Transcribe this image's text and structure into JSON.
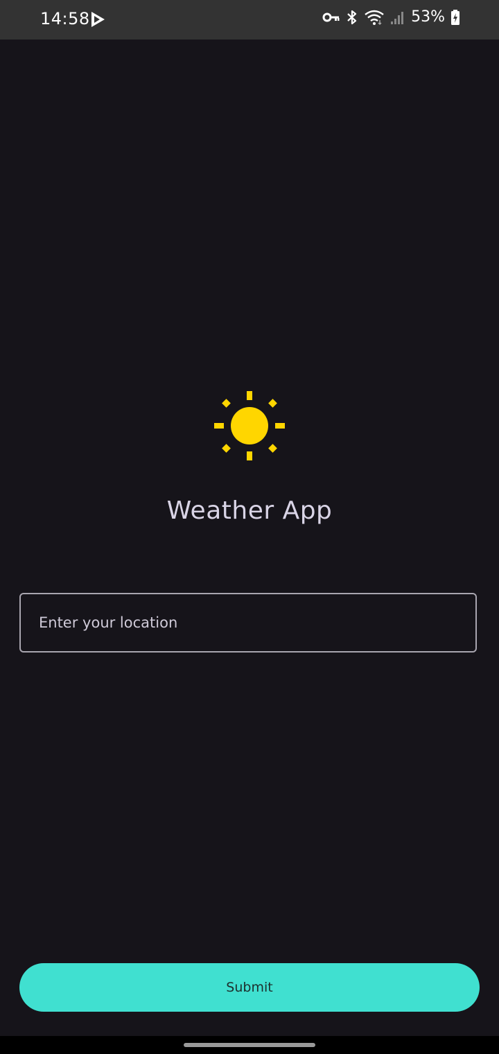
{
  "status_bar": {
    "time": "14:58",
    "battery_percent": "53%",
    "icons": [
      "play-store-icon",
      "vpn-key-icon",
      "bluetooth-icon",
      "wifi-icon",
      "cell-signal-icon",
      "battery-charging-icon"
    ]
  },
  "app": {
    "title": "Weather App",
    "logo_icon": "sun-icon",
    "sun_color": "#FFD600"
  },
  "location_input": {
    "placeholder": "Enter your location",
    "value": ""
  },
  "submit": {
    "label": "Submit",
    "color": "#40E0D0"
  },
  "theme": {
    "background": "#16141A",
    "text": "#D9D4E6"
  }
}
